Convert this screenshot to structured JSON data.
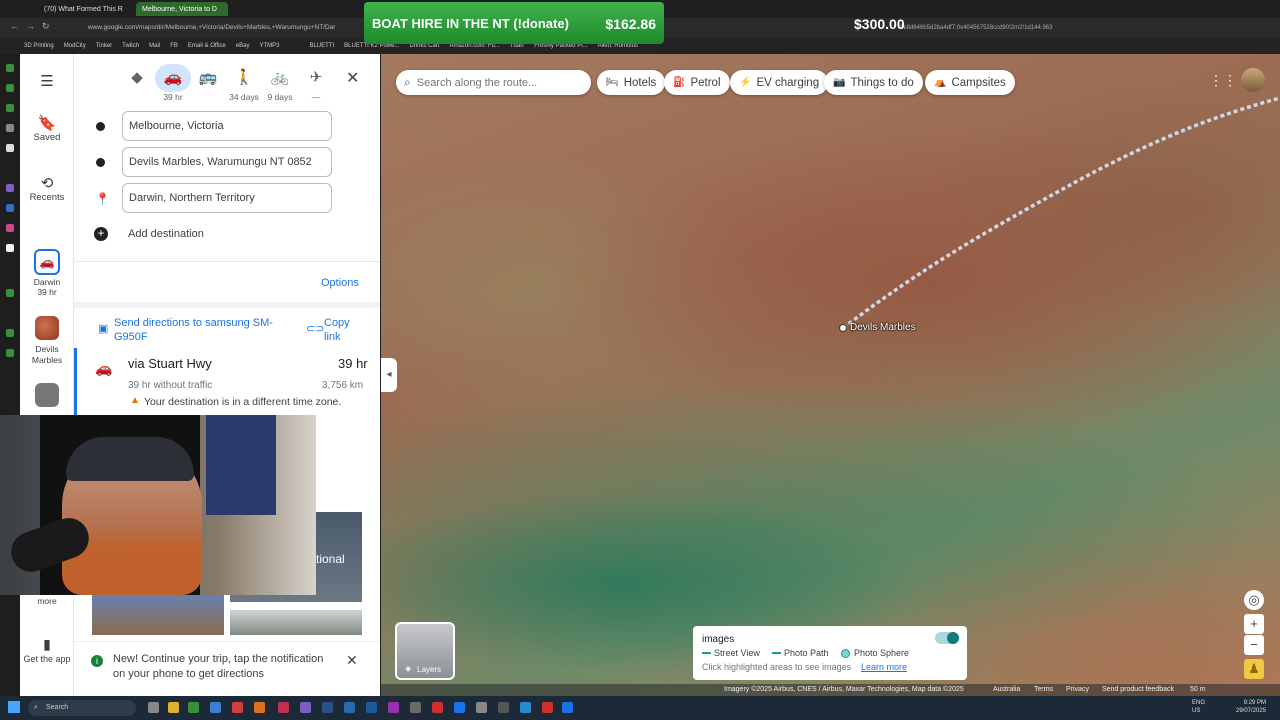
{
  "browser": {
    "tab1": "(70) What Formed This R",
    "tab2": "Melbourne, Victoria to D",
    "url": "www.google.com/maps/dir/Melbourne,+Victoria/Devils+Marbles,+Warumungu+NT/Dar",
    "url_tail": "8e8d646b5d2ba4df7:0x404567528ccd90!2m2!1d144.963",
    "bookmarks": [
      "3D Printing",
      "ModCity",
      "Tinker",
      "Twitch",
      "Mail",
      "FB",
      "Email & Office",
      "eBay",
      "YTMP3",
      "",
      "",
      "BLUETTI",
      "BLUETTI K2 Powe...",
      "Drinks Cart",
      "Amazon.com: Fu...",
      "Tdarr",
      "Freshly Packed Pi...",
      "Alien: Romulus"
    ]
  },
  "donation": {
    "title": "BOAT HIRE IN THE NT (!donate)",
    "amount": "$162.86",
    "goal": "$300.00"
  },
  "rail": {
    "saved": "Saved",
    "recents": "Recents",
    "darwin": "Darwin",
    "darwin_time": "39 hr",
    "devils": "Devils Marbles",
    "more": "more",
    "get_app": "Get the app"
  },
  "modes": [
    {
      "icon": "◆",
      "label": ""
    },
    {
      "icon": "🚗",
      "label": "39 hr"
    },
    {
      "icon": "🚌",
      "label": ""
    },
    {
      "icon": "🚶",
      "label": "34 days"
    },
    {
      "icon": "🚲",
      "label": "9 days"
    },
    {
      "icon": "✈",
      "label": "—"
    }
  ],
  "waypoints": [
    "Melbourne, Victoria",
    "Devils Marbles, Warumungu NT 0852",
    "Darwin, Northern Territory"
  ],
  "add_destination": "Add destination",
  "options": "Options",
  "send_directions": "Send directions to samsung SM-G950F",
  "copy_link": "Copy link",
  "route": {
    "via": "via Stuart Hwy",
    "time": "39 hr",
    "traffic": "39 hr without traffic",
    "distance": "3,756 km",
    "warning": "Your destination is in a different time zone."
  },
  "webcam_text": "tional",
  "notification": "New! Continue your trip, tap the notification on your phone to get directions",
  "map": {
    "search_placeholder": "Search along the route...",
    "chips": [
      "Hotels",
      "Petrol",
      "EV charging",
      "Things to do",
      "Campsites"
    ],
    "pin_label": "Devils Marbles",
    "layers": "Layers",
    "photo_legend": {
      "title": "images",
      "street_view": "Street View",
      "photo_path": "Photo Path",
      "photo_sphere": "Photo Sphere",
      "hint": "Click highlighted areas to see images",
      "learn": "Learn more"
    },
    "attribution": "Imagery ©2025 Airbus, CNES / Airbus, Maxar Technologies, Map data ©2025",
    "region": "Australia",
    "terms": "Terms",
    "privacy": "Privacy",
    "feedback": "Send product feedback",
    "scale": "50 m"
  },
  "taskbar": {
    "search": "Search",
    "lang": "ENG",
    "region": "US",
    "time": "9:29 PM",
    "date": "29/07/2025"
  }
}
